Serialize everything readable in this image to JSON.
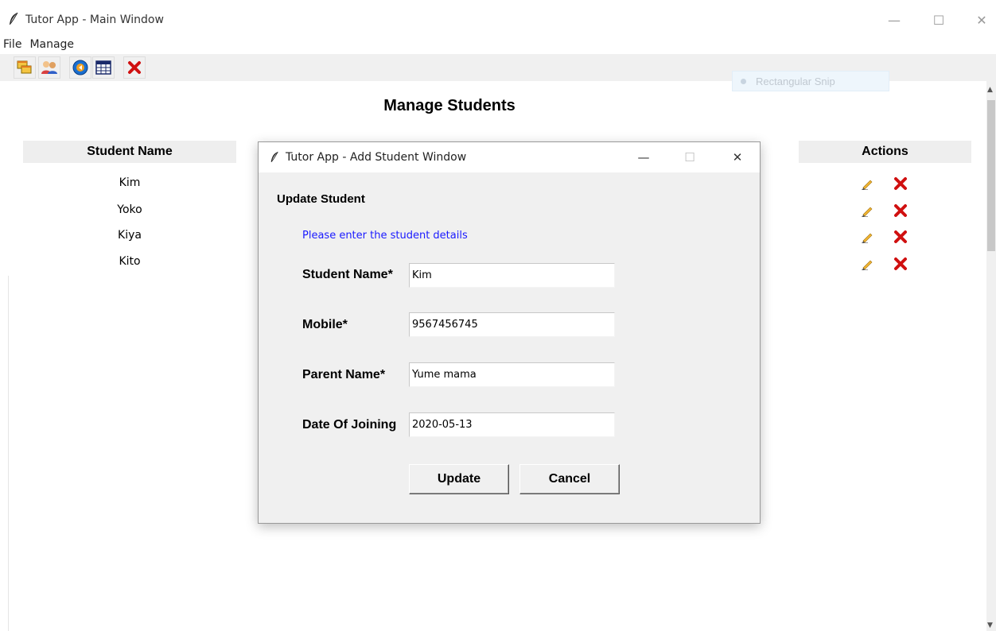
{
  "main_window": {
    "title": "Tutor App - Main Window",
    "controls": {
      "minimize": "—",
      "maximize": "☐",
      "close": "✕"
    }
  },
  "menu": [
    "File",
    "Manage"
  ],
  "toolbar": {
    "icons": [
      "windows-icon",
      "users-icon",
      "help-icon",
      "table-icon",
      "exit-icon"
    ]
  },
  "snip_overlay": {
    "label": "Rectangular Snip"
  },
  "page": {
    "title": "Manage Students",
    "columns": {
      "name": "Student Name",
      "actions": "Actions"
    },
    "students": [
      "Kim",
      "Yoko",
      "Kiya",
      "Kito"
    ]
  },
  "dialog": {
    "title": "Tutor App - Add Student Window",
    "controls": {
      "minimize": "—",
      "maximize": "☐",
      "close": "✕"
    },
    "heading": "Update Student",
    "instruction": "Please enter the student details",
    "fields": [
      {
        "label": "Student Name*",
        "value": "Kim"
      },
      {
        "label": "Mobile*",
        "value": "9567456745"
      },
      {
        "label": "Parent Name*",
        "value": "Yume mama"
      },
      {
        "label": "Date Of Joining",
        "value": "2020-05-13"
      }
    ],
    "buttons": {
      "update": "Update",
      "cancel": "Cancel"
    }
  },
  "colors": {
    "instruction": "#1a1aff",
    "delete": "#d01010",
    "header_bg": "#eeeeee",
    "dialog_bg": "#f0f0f0"
  }
}
